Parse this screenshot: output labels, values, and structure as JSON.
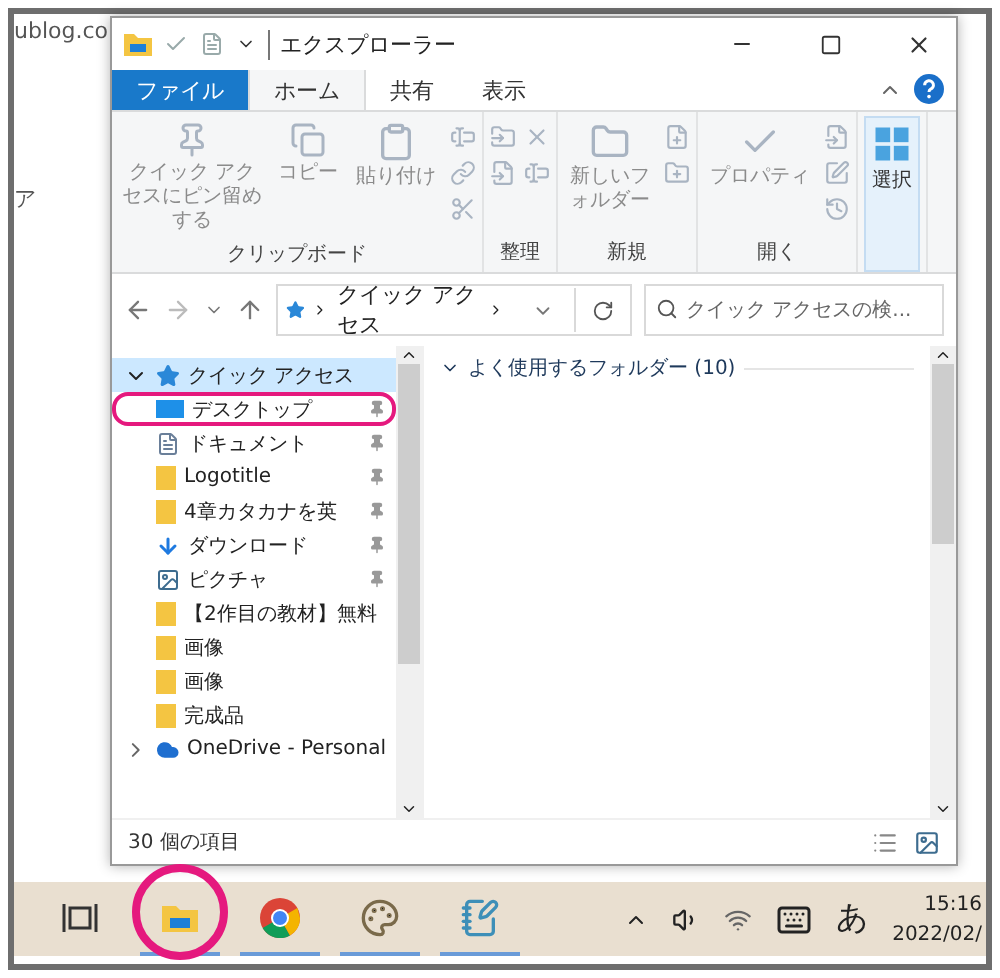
{
  "backdrop": {
    "texts": [
      "ublog.co",
      "ア"
    ]
  },
  "window": {
    "title": "エクスプローラー"
  },
  "ribbon": {
    "tabs": [
      {
        "label": "ファイル",
        "kind": "file",
        "selected": false
      },
      {
        "label": "ホーム",
        "kind": "tab",
        "selected": true
      },
      {
        "label": "共有",
        "kind": "tab",
        "selected": false
      },
      {
        "label": "表示",
        "kind": "tab",
        "selected": false
      }
    ],
    "groups": [
      {
        "label": "クリップボード",
        "items": [
          {
            "kind": "pin",
            "label": "クイック アクセスにピン留めする",
            "disabled": true
          },
          {
            "kind": "copy",
            "label": "コピー",
            "disabled": true
          },
          {
            "kind": "paste",
            "label": "貼り付け",
            "disabled": true
          },
          {
            "kind": "clip-tools"
          }
        ]
      },
      {
        "label": "整理",
        "items": [
          {
            "kind": "move-tools"
          },
          {
            "kind": "delete-tools"
          }
        ]
      },
      {
        "label": "新規",
        "items": [
          {
            "kind": "new-folder",
            "label": "新しいフォルダー",
            "disabled": true
          },
          {
            "kind": "new-tools"
          }
        ]
      },
      {
        "label": "開く",
        "items": [
          {
            "kind": "properties",
            "label": "プロパティ",
            "disabled": true
          },
          {
            "kind": "open-tools"
          }
        ]
      },
      {
        "items": [
          {
            "kind": "select",
            "label": "選択",
            "disabled": false
          }
        ]
      }
    ]
  },
  "address": {
    "path": [
      "クイック アクセス"
    ],
    "search": {
      "placeholder": "クイック アクセスの検..."
    }
  },
  "nav": [
    {
      "label": "クイック アクセス",
      "kind": "star",
      "expanded": true,
      "selected": true,
      "children": [
        {
          "label": "デスクトップ",
          "kind": "desktop",
          "pinned": true,
          "circled": true,
          "selected": false
        },
        {
          "label": "ドキュメント",
          "kind": "document",
          "pinned": true,
          "circled": false,
          "selected": false
        },
        {
          "label": "Logotitle",
          "kind": "folder",
          "pinned": true,
          "circled": false,
          "selected": false
        },
        {
          "label": "4章カタカナを英",
          "kind": "folder",
          "pinned": true,
          "circled": false,
          "selected": false
        },
        {
          "label": "ダウンロード",
          "kind": "download",
          "pinned": true,
          "circled": false,
          "selected": false
        },
        {
          "label": "ピクチャ",
          "kind": "picture",
          "pinned": true,
          "circled": false,
          "selected": false
        },
        {
          "label": "【2作目の教材】無料",
          "kind": "folder",
          "pinned": false,
          "circled": false,
          "selected": false
        },
        {
          "label": "画像",
          "kind": "folder",
          "pinned": false,
          "circled": false,
          "selected": false
        },
        {
          "label": "画像",
          "kind": "folder",
          "pinned": false,
          "circled": false,
          "selected": false
        },
        {
          "label": "完成品",
          "kind": "folder",
          "pinned": false,
          "circled": false,
          "selected": false
        }
      ]
    },
    {
      "label": "OneDrive - Personal",
      "kind": "cloud",
      "expanded": false,
      "selected": false
    }
  ],
  "content": {
    "group": {
      "label": "よく使用するフォルダー (10)",
      "expanded": true
    }
  },
  "status_bar": {
    "text": "30 個の項目"
  },
  "taskbar": {
    "apps": [
      {
        "kind": "task-view",
        "running": false,
        "circled": false
      },
      {
        "kind": "explorer",
        "running": true,
        "circled": true
      },
      {
        "kind": "browser",
        "running": true,
        "circled": false
      },
      {
        "kind": "paint",
        "running": true,
        "circled": false
      },
      {
        "kind": "notepad",
        "running": true,
        "circled": false
      }
    ],
    "ime": "あ",
    "time": "15:16",
    "date": "2022/02/"
  }
}
